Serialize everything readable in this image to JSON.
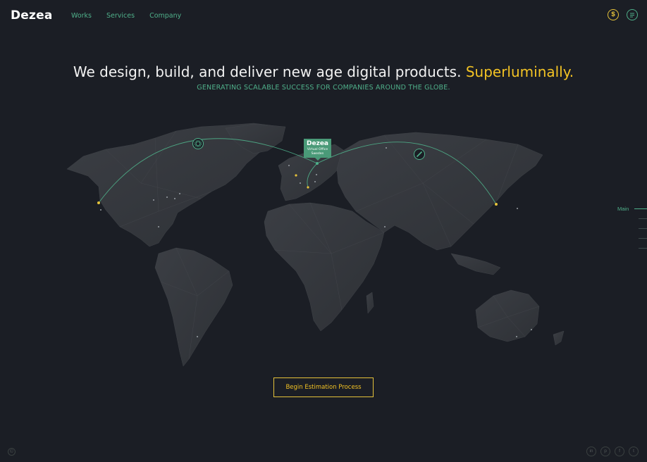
{
  "brand": {
    "logo": "Dezea"
  },
  "nav": {
    "items": [
      "Works",
      "Services",
      "Company"
    ]
  },
  "top_icons": {
    "pricing": "dollar-icon",
    "chat": "chat-icon",
    "dollar_glyph": "$"
  },
  "hero": {
    "headline": "We design, build, and deliver new age digital products.",
    "headline_accent": "Superluminally.",
    "subline": "GENERATING SCALABLE SUCCESS FOR COMPANIES AROUND THE GLOBE."
  },
  "map": {
    "marker": {
      "title": "Dezea",
      "line1": "Virtual Office",
      "line2": "Sweden"
    },
    "route_icons": [
      "gear-icon",
      "pencil-icon"
    ]
  },
  "side_nav": {
    "active": "Main"
  },
  "cta": {
    "label": "Begin Estimation Process"
  },
  "footer": {
    "copyright_glyph": "©",
    "social": [
      {
        "name": "linkedin-icon",
        "glyph": "in"
      },
      {
        "name": "pinterest-icon",
        "glyph": "p"
      },
      {
        "name": "facebook-icon",
        "glyph": "f"
      },
      {
        "name": "twitter-icon",
        "glyph": "t"
      }
    ]
  },
  "colors": {
    "background": "#1b1e25",
    "accent": "#f3c324",
    "green": "#4fb08a",
    "land": "#34373d"
  }
}
